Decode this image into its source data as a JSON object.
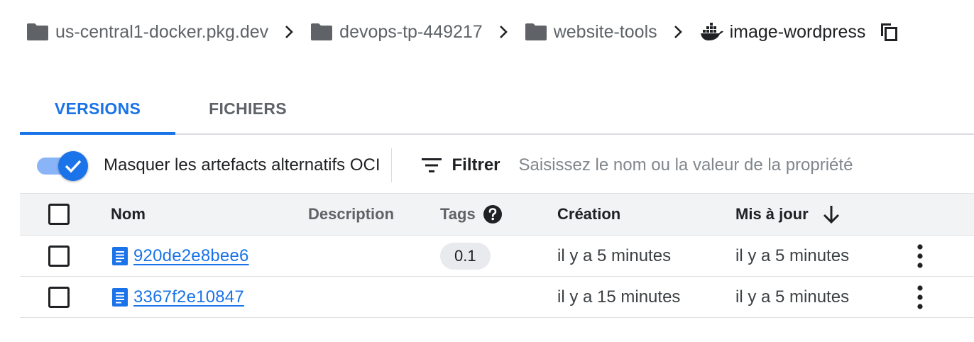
{
  "breadcrumb": {
    "items": [
      {
        "label": "us-central1-docker.pkg.dev",
        "icon": "folder-icon"
      },
      {
        "label": "devops-tp-449217",
        "icon": "folder-icon"
      },
      {
        "label": "website-tools",
        "icon": "folder-icon"
      },
      {
        "label": "image-wordpress",
        "icon": "docker-icon"
      }
    ],
    "separator_icon": "chevron-right-icon",
    "copy_icon": "copy-icon"
  },
  "tabs": [
    {
      "label": "VERSIONS",
      "active": true
    },
    {
      "label": "FICHIERS",
      "active": false
    }
  ],
  "filterbar": {
    "toggle_label": "Masquer les artefacts alternatifs OCI",
    "toggle_on": true,
    "filter_label": "Filtrer",
    "filter_placeholder": "Saisissez le nom ou la valeur de la propriété"
  },
  "table": {
    "columns": {
      "nom": "Nom",
      "description": "Description",
      "tags": "Tags",
      "creation": "Création",
      "mis_a_jour": "Mis à jour"
    },
    "rows": [
      {
        "nom": "920de2e8bee6",
        "description": "",
        "tag": "0.1",
        "creation": "il y a 5 minutes",
        "mis_a_jour": "il y a 5 minutes"
      },
      {
        "nom": "3367f2e10847",
        "description": "",
        "tag": "",
        "creation": "il y a 15 minutes",
        "mis_a_jour": "il y a 5 minutes"
      }
    ]
  },
  "colors": {
    "accent": "#1a73e8",
    "accent_light": "#8ab4f8",
    "text": "#202124",
    "muted": "#5f6368",
    "header_bg": "#f1f3f4",
    "chip_bg": "#e8eaed"
  }
}
